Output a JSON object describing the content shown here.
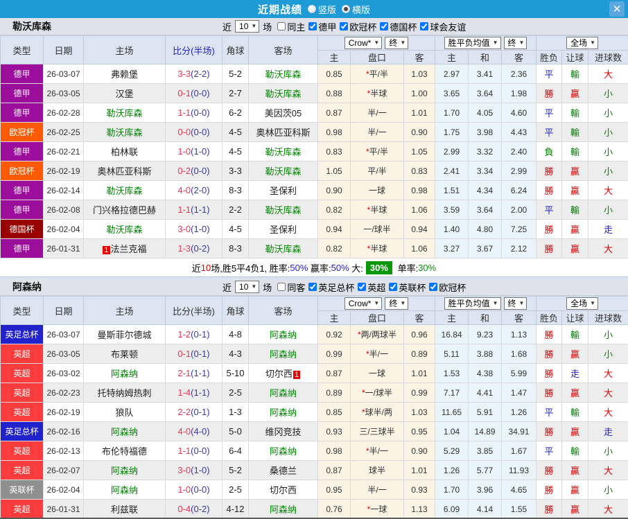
{
  "titlebar": {
    "title": "近期战绩",
    "vertical_label": "竖版",
    "horizontal_label": "横版",
    "selected_layout": "横版",
    "close_glyph": "✕"
  },
  "table": {
    "headers": {
      "type": "类型",
      "date": "日期",
      "home": "主场",
      "score": "比分(半场)",
      "corner": "角球",
      "away": "客场",
      "odds_home": "主",
      "handicap": "盘口",
      "odds_away": "客",
      "avg_home": "主",
      "avg_draw": "和",
      "avg_away": "客",
      "wdl": "胜负",
      "handicap_result": "让球",
      "goals": "进球数"
    },
    "dropdowns": {
      "source": "Crow*",
      "final1": "终",
      "avg": "胜平负均值",
      "final2": "终",
      "scope": "全场"
    }
  },
  "type_colors": {
    "德甲": "#9C0D9C",
    "欧冠杯": "#FF5A00",
    "德国杯": "#990000",
    "英足总杯": "#2222CC",
    "英超": "#FA3C3C",
    "英联杯": "#8F8F8F"
  },
  "result_colors": {
    "red": "#DD0000",
    "blue": "#2222CC",
    "green": "#008000"
  },
  "sections": [
    {
      "team": "勒沃库森",
      "near_label": "近",
      "count": "10",
      "unit_label": "场",
      "same_label": "同主",
      "same_checked": false,
      "leagues": [
        {
          "label": "德甲",
          "checked": true
        },
        {
          "label": "欧冠杯",
          "checked": true
        },
        {
          "label": "德国杯",
          "checked": true
        },
        {
          "label": "球会友谊",
          "checked": true
        }
      ],
      "rows": [
        {
          "type": "德甲",
          "date": "26-03-07",
          "home": "弗赖堡",
          "home_focus": false,
          "home_rank": "",
          "score": "3-3",
          "half": "(2-2)",
          "corner": "5-2",
          "away": "勒沃库森",
          "away_focus": true,
          "away_rank": "",
          "odds_home": "0.85",
          "handicap": "*平/半",
          "odds_away": "1.03",
          "avg_home": "2.97",
          "avg_draw": "3.41",
          "avg_away": "2.36",
          "wdl": "平",
          "wdl_c": "blue",
          "rang": "輸",
          "rang_c": "green",
          "big": "大",
          "big_c": "red"
        },
        {
          "type": "德甲",
          "date": "26-03-05",
          "home": "汉堡",
          "home_focus": false,
          "home_rank": "",
          "score": "0-1",
          "half": "(0-0)",
          "corner": "2-7",
          "away": "勒沃库森",
          "away_focus": true,
          "away_rank": "",
          "odds_home": "0.88",
          "handicap": "*半球",
          "odds_away": "1.00",
          "avg_home": "3.65",
          "avg_draw": "3.64",
          "avg_away": "1.98",
          "wdl": "勝",
          "wdl_c": "red",
          "rang": "贏",
          "rang_c": "red",
          "big": "小",
          "big_c": "green"
        },
        {
          "type": "德甲",
          "date": "26-02-28",
          "home": "勒沃库森",
          "home_focus": true,
          "home_rank": "",
          "score": "1-1",
          "half": "(0-0)",
          "corner": "6-2",
          "away": "美因茨05",
          "away_focus": false,
          "away_rank": "",
          "odds_home": "0.87",
          "handicap": "半/一",
          "odds_away": "1.01",
          "avg_home": "1.70",
          "avg_draw": "4.05",
          "avg_away": "4.60",
          "wdl": "平",
          "wdl_c": "blue",
          "rang": "輸",
          "rang_c": "green",
          "big": "小",
          "big_c": "green"
        },
        {
          "type": "欧冠杯",
          "date": "26-02-25",
          "home": "勒沃库森",
          "home_focus": true,
          "home_rank": "",
          "score": "0-0",
          "half": "(0-0)",
          "corner": "4-5",
          "away": "奥林匹亚科斯",
          "away_focus": false,
          "away_rank": "",
          "odds_home": "0.98",
          "handicap": "半/一",
          "odds_away": "0.90",
          "avg_home": "1.75",
          "avg_draw": "3.98",
          "avg_away": "4.43",
          "wdl": "平",
          "wdl_c": "blue",
          "rang": "輸",
          "rang_c": "green",
          "big": "小",
          "big_c": "green"
        },
        {
          "type": "德甲",
          "date": "26-02-21",
          "home": "柏林联",
          "home_focus": false,
          "home_rank": "",
          "score": "1-0",
          "half": "(1-0)",
          "corner": "4-5",
          "away": "勒沃库森",
          "away_focus": true,
          "away_rank": "",
          "odds_home": "0.83",
          "handicap": "*平/半",
          "odds_away": "1.05",
          "avg_home": "2.99",
          "avg_draw": "3.32",
          "avg_away": "2.40",
          "wdl": "負",
          "wdl_c": "green",
          "rang": "輸",
          "rang_c": "green",
          "big": "小",
          "big_c": "green"
        },
        {
          "type": "欧冠杯",
          "date": "26-02-19",
          "home": "奥林匹亚科斯",
          "home_focus": false,
          "home_rank": "",
          "score": "0-2",
          "half": "(0-0)",
          "corner": "3-3",
          "away": "勒沃库森",
          "away_focus": true,
          "away_rank": "",
          "odds_home": "1.05",
          "handicap": "平/半",
          "odds_away": "0.83",
          "avg_home": "2.41",
          "avg_draw": "3.34",
          "avg_away": "2.99",
          "wdl": "勝",
          "wdl_c": "red",
          "rang": "贏",
          "rang_c": "red",
          "big": "小",
          "big_c": "green"
        },
        {
          "type": "德甲",
          "date": "26-02-14",
          "home": "勒沃库森",
          "home_focus": true,
          "home_rank": "",
          "score": "4-0",
          "half": "(2-0)",
          "corner": "8-3",
          "away": "圣保利",
          "away_focus": false,
          "away_rank": "",
          "odds_home": "0.90",
          "handicap": "一球",
          "odds_away": "0.98",
          "avg_home": "1.51",
          "avg_draw": "4.34",
          "avg_away": "6.24",
          "wdl": "勝",
          "wdl_c": "red",
          "rang": "贏",
          "rang_c": "red",
          "big": "大",
          "big_c": "red"
        },
        {
          "type": "德甲",
          "date": "26-02-08",
          "home": "门兴格拉德巴赫",
          "home_focus": false,
          "home_rank": "",
          "score": "1-1",
          "half": "(1-1)",
          "corner": "2-2",
          "away": "勒沃库森",
          "away_focus": true,
          "away_rank": "",
          "odds_home": "0.82",
          "handicap": "*半球",
          "odds_away": "1.06",
          "avg_home": "3.59",
          "avg_draw": "3.64",
          "avg_away": "2.00",
          "wdl": "平",
          "wdl_c": "blue",
          "rang": "輸",
          "rang_c": "green",
          "big": "小",
          "big_c": "green"
        },
        {
          "type": "德国杯",
          "date": "26-02-04",
          "home": "勒沃库森",
          "home_focus": true,
          "home_rank": "",
          "score": "3-0",
          "half": "(1-0)",
          "corner": "4-5",
          "away": "圣保利",
          "away_focus": false,
          "away_rank": "",
          "odds_home": "0.94",
          "handicap": "一/球半",
          "odds_away": "0.94",
          "avg_home": "1.40",
          "avg_draw": "4.80",
          "avg_away": "7.25",
          "wdl": "勝",
          "wdl_c": "red",
          "rang": "贏",
          "rang_c": "red",
          "big": "走",
          "big_c": "blue"
        },
        {
          "type": "德甲",
          "date": "26-01-31",
          "home": "法兰克福",
          "home_focus": false,
          "home_rank": "1",
          "score": "1-3",
          "half": "(0-2)",
          "corner": "8-3",
          "away": "勒沃库森",
          "away_focus": true,
          "away_rank": "",
          "odds_home": "0.82",
          "handicap": "*半球",
          "odds_away": "1.06",
          "avg_home": "3.27",
          "avg_draw": "3.67",
          "avg_away": "2.12",
          "wdl": "勝",
          "wdl_c": "red",
          "rang": "贏",
          "rang_c": "red",
          "big": "大",
          "big_c": "red"
        }
      ],
      "summary": {
        "t0": "近",
        "count": "10",
        "t1": "场,胜5平4负1, 胜率:",
        "win_rate": "50%",
        "t2": " 赢率:",
        "cover_rate": "50%",
        "t3": " 大:",
        "big_rate": "30%",
        "t4": " 单率:",
        "single_rate": "30%"
      }
    },
    {
      "team": "阿森纳",
      "near_label": "近",
      "count": "10",
      "unit_label": "场",
      "same_label": "同客",
      "same_checked": false,
      "leagues": [
        {
          "label": "英足总杯",
          "checked": true
        },
        {
          "label": "英超",
          "checked": true
        },
        {
          "label": "英联杯",
          "checked": true
        },
        {
          "label": "欧冠杯",
          "checked": true
        }
      ],
      "rows": [
        {
          "type": "英足总杯",
          "date": "26-03-07",
          "home": "曼斯菲尔德城",
          "home_focus": false,
          "home_rank": "",
          "score": "1-2",
          "half": "(0-1)",
          "corner": "4-8",
          "away": "阿森纳",
          "away_focus": true,
          "away_rank": "",
          "odds_home": "0.92",
          "handicap": "*两/两球半",
          "odds_away": "0.96",
          "avg_home": "16.84",
          "avg_draw": "9.23",
          "avg_away": "1.13",
          "wdl": "勝",
          "wdl_c": "red",
          "rang": "輸",
          "rang_c": "green",
          "big": "小",
          "big_c": "green"
        },
        {
          "type": "英超",
          "date": "26-03-05",
          "home": "布莱顿",
          "home_focus": false,
          "home_rank": "",
          "score": "0-1",
          "half": "(0-1)",
          "corner": "4-3",
          "away": "阿森纳",
          "away_focus": true,
          "away_rank": "",
          "odds_home": "0.99",
          "handicap": "*半/一",
          "odds_away": "0.89",
          "avg_home": "5.11",
          "avg_draw": "3.88",
          "avg_away": "1.68",
          "wdl": "勝",
          "wdl_c": "red",
          "rang": "贏",
          "rang_c": "red",
          "big": "小",
          "big_c": "green"
        },
        {
          "type": "英超",
          "date": "26-03-02",
          "home": "阿森纳",
          "home_focus": true,
          "home_rank": "",
          "score": "2-1",
          "half": "(1-1)",
          "corner": "5-10",
          "away": "切尔西",
          "away_focus": false,
          "away_rank": "1",
          "odds_home": "0.87",
          "handicap": "一球",
          "odds_away": "1.01",
          "avg_home": "1.53",
          "avg_draw": "4.38",
          "avg_away": "5.99",
          "wdl": "勝",
          "wdl_c": "red",
          "rang": "走",
          "rang_c": "blue",
          "big": "大",
          "big_c": "red"
        },
        {
          "type": "英超",
          "date": "26-02-23",
          "home": "托特纳姆热刺",
          "home_focus": false,
          "home_rank": "",
          "score": "1-4",
          "half": "(1-1)",
          "corner": "2-5",
          "away": "阿森纳",
          "away_focus": true,
          "away_rank": "",
          "odds_home": "0.89",
          "handicap": "*一/球半",
          "odds_away": "0.99",
          "avg_home": "7.17",
          "avg_draw": "4.41",
          "avg_away": "1.47",
          "wdl": "勝",
          "wdl_c": "red",
          "rang": "贏",
          "rang_c": "red",
          "big": "大",
          "big_c": "red"
        },
        {
          "type": "英超",
          "date": "26-02-19",
          "home": "狼队",
          "home_focus": false,
          "home_rank": "",
          "score": "2-2",
          "half": "(0-1)",
          "corner": "1-3",
          "away": "阿森纳",
          "away_focus": true,
          "away_rank": "",
          "odds_home": "0.85",
          "handicap": "*球半/两",
          "odds_away": "1.03",
          "avg_home": "11.65",
          "avg_draw": "5.91",
          "avg_away": "1.26",
          "wdl": "平",
          "wdl_c": "blue",
          "rang": "輸",
          "rang_c": "green",
          "big": "大",
          "big_c": "red"
        },
        {
          "type": "英足总杯",
          "date": "26-02-16",
          "home": "阿森纳",
          "home_focus": true,
          "home_rank": "",
          "score": "4-0",
          "half": "(4-0)",
          "corner": "5-0",
          "away": "维冈竞技",
          "away_focus": false,
          "away_rank": "",
          "odds_home": "0.93",
          "handicap": "三/三球半",
          "odds_away": "0.95",
          "avg_home": "1.04",
          "avg_draw": "14.89",
          "avg_away": "34.91",
          "wdl": "勝",
          "wdl_c": "red",
          "rang": "贏",
          "rang_c": "red",
          "big": "走",
          "big_c": "blue"
        },
        {
          "type": "英超",
          "date": "26-02-13",
          "home": "布伦特福德",
          "home_focus": false,
          "home_rank": "",
          "score": "1-1",
          "half": "(0-0)",
          "corner": "6-4",
          "away": "阿森纳",
          "away_focus": true,
          "away_rank": "",
          "odds_home": "0.98",
          "handicap": "*半/一",
          "odds_away": "0.90",
          "avg_home": "5.29",
          "avg_draw": "3.85",
          "avg_away": "1.67",
          "wdl": "平",
          "wdl_c": "blue",
          "rang": "輸",
          "rang_c": "green",
          "big": "小",
          "big_c": "green"
        },
        {
          "type": "英超",
          "date": "26-02-07",
          "home": "阿森纳",
          "home_focus": true,
          "home_rank": "",
          "score": "3-0",
          "half": "(1-0)",
          "corner": "5-2",
          "away": "桑德兰",
          "away_focus": false,
          "away_rank": "",
          "odds_home": "0.87",
          "handicap": "球半",
          "odds_away": "1.01",
          "avg_home": "1.26",
          "avg_draw": "5.77",
          "avg_away": "11.93",
          "wdl": "勝",
          "wdl_c": "red",
          "rang": "贏",
          "rang_c": "red",
          "big": "大",
          "big_c": "red"
        },
        {
          "type": "英联杯",
          "date": "26-02-04",
          "home": "阿森纳",
          "home_focus": true,
          "home_rank": "",
          "score": "1-0",
          "half": "(0-0)",
          "corner": "2-5",
          "away": "切尔西",
          "away_focus": false,
          "away_rank": "",
          "odds_home": "0.95",
          "handicap": "半/一",
          "odds_away": "0.93",
          "avg_home": "1.70",
          "avg_draw": "3.96",
          "avg_away": "4.65",
          "wdl": "勝",
          "wdl_c": "red",
          "rang": "贏",
          "rang_c": "red",
          "big": "小",
          "big_c": "green"
        },
        {
          "type": "英超",
          "date": "26-01-31",
          "home": "利兹联",
          "home_focus": false,
          "home_rank": "",
          "score": "0-4",
          "half": "(0-2)",
          "corner": "4-12",
          "away": "阿森纳",
          "away_focus": true,
          "away_rank": "",
          "odds_home": "0.76",
          "handicap": "*一球",
          "odds_away": "1.13",
          "avg_home": "6.09",
          "avg_draw": "4.14",
          "avg_away": "1.55",
          "wdl": "勝",
          "wdl_c": "red",
          "rang": "贏",
          "rang_c": "red",
          "big": "大",
          "big_c": "red"
        }
      ],
      "summary": null
    }
  ]
}
